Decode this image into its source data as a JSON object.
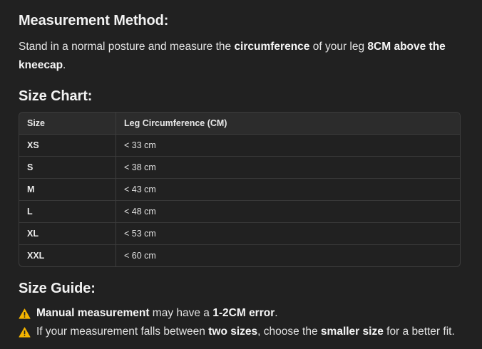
{
  "method": {
    "heading": "Measurement Method:",
    "p1": "Stand in a normal posture and measure the ",
    "b1": "circumference",
    "p2": " of your leg ",
    "b2": "8CM above the kneecap",
    "p3": "."
  },
  "chart": {
    "heading": "Size Chart:",
    "columns": [
      "Size",
      "Leg Circumference (CM)"
    ],
    "rows": [
      {
        "size": "XS",
        "circumference": "< 33 cm"
      },
      {
        "size": "S",
        "circumference": "< 38 cm"
      },
      {
        "size": "M",
        "circumference": "< 43 cm"
      },
      {
        "size": "L",
        "circumference": "< 48 cm"
      },
      {
        "size": "XL",
        "circumference": "< 53 cm"
      },
      {
        "size": "XXL",
        "circumference": "< 60 cm"
      }
    ]
  },
  "guide": {
    "heading": "Size Guide:",
    "icon": "warning-icon",
    "icon_color": "#f4b400",
    "line1": {
      "b1": "Manual measurement",
      "t1": " may have a ",
      "b2": "1-2CM error",
      "t2": "."
    },
    "line2": {
      "t1": "If your measurement falls between ",
      "b1": "two sizes",
      "t2": ", choose the ",
      "b2": "smaller size",
      "t3": " for a better fit."
    }
  }
}
